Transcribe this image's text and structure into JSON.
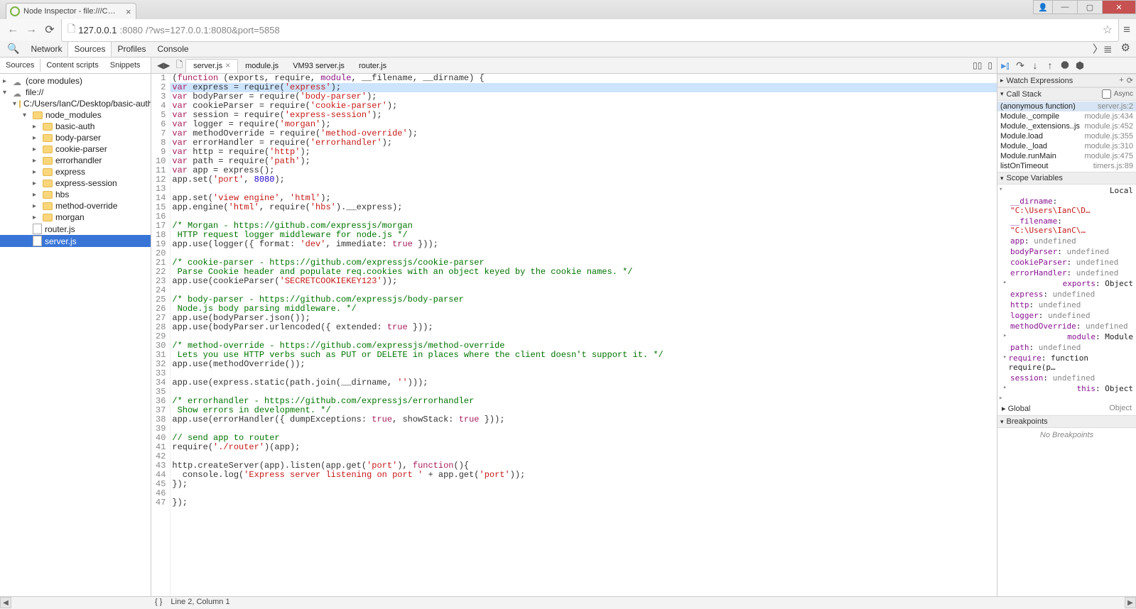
{
  "browser": {
    "tab_title": "Node Inspector - file:///C…",
    "url_host": "127.0.0.1",
    "url_port": ":8080",
    "url_rest": "/?ws=127.0.0.1:8080&port=5858"
  },
  "devtools": {
    "tabs": [
      "Network",
      "Sources",
      "Profiles",
      "Console"
    ],
    "active_tab": "Sources"
  },
  "left_tabs": [
    "Sources",
    "Content scripts",
    "Snippets"
  ],
  "tree": {
    "core": "(core modules)",
    "file": "file://",
    "path": "C:/Users/IanC/Desktop/basic-auth",
    "node_modules": "node_modules",
    "folders": [
      "basic-auth",
      "body-parser",
      "cookie-parser",
      "errorhandler",
      "express",
      "express-session",
      "hbs",
      "method-override",
      "morgan"
    ],
    "files": [
      "router.js",
      "server.js"
    ],
    "selected": "server.js"
  },
  "editor": {
    "tabs": [
      "server.js",
      "module.js",
      "VM93 server.js",
      "router.js"
    ],
    "active": "server.js",
    "status": "Line 2, Column 1"
  },
  "code": [
    {
      "n": 1,
      "t": "(function (exports, require, module, __filename, __dirname) {",
      "tokens": [
        [
          "fn",
          "("
        ],
        [
          "kw",
          "function"
        ],
        [
          "fn",
          " (exports, require, "
        ],
        [
          "obj",
          "module"
        ],
        [
          "fn",
          ", __filename, __dirname) {"
        ]
      ]
    },
    {
      "n": 2,
      "hl": true,
      "tokens": [
        [
          "kw",
          "var"
        ],
        [
          "fn",
          " express = require("
        ],
        [
          "str",
          "'express'"
        ],
        [
          "fn",
          ");"
        ]
      ]
    },
    {
      "n": 3,
      "tokens": [
        [
          "kw",
          "var"
        ],
        [
          "fn",
          " bodyParser = require("
        ],
        [
          "str",
          "'body-parser'"
        ],
        [
          "fn",
          ");"
        ]
      ]
    },
    {
      "n": 4,
      "tokens": [
        [
          "kw",
          "var"
        ],
        [
          "fn",
          " cookieParser = require("
        ],
        [
          "str",
          "'cookie-parser'"
        ],
        [
          "fn",
          ");"
        ]
      ]
    },
    {
      "n": 5,
      "tokens": [
        [
          "kw",
          "var"
        ],
        [
          "fn",
          " session = require("
        ],
        [
          "str",
          "'express-session'"
        ],
        [
          "fn",
          ");"
        ]
      ]
    },
    {
      "n": 6,
      "tokens": [
        [
          "kw",
          "var"
        ],
        [
          "fn",
          " logger = require("
        ],
        [
          "str",
          "'morgan'"
        ],
        [
          "fn",
          ");"
        ]
      ]
    },
    {
      "n": 7,
      "tokens": [
        [
          "kw",
          "var"
        ],
        [
          "fn",
          " methodOverride = require("
        ],
        [
          "str",
          "'method-override'"
        ],
        [
          "fn",
          ");"
        ]
      ]
    },
    {
      "n": 8,
      "tokens": [
        [
          "kw",
          "var"
        ],
        [
          "fn",
          " errorHandler = require("
        ],
        [
          "str",
          "'errorhandler'"
        ],
        [
          "fn",
          ");"
        ]
      ]
    },
    {
      "n": 9,
      "tokens": [
        [
          "kw",
          "var"
        ],
        [
          "fn",
          " http = require("
        ],
        [
          "str",
          "'http'"
        ],
        [
          "fn",
          ");"
        ]
      ]
    },
    {
      "n": 10,
      "tokens": [
        [
          "kw",
          "var"
        ],
        [
          "fn",
          " path = require("
        ],
        [
          "str",
          "'path'"
        ],
        [
          "fn",
          ");"
        ]
      ]
    },
    {
      "n": 11,
      "tokens": [
        [
          "kw",
          "var"
        ],
        [
          "fn",
          " app = express();"
        ]
      ]
    },
    {
      "n": 12,
      "tokens": [
        [
          "fn",
          "app.set("
        ],
        [
          "str",
          "'port'"
        ],
        [
          "fn",
          ", "
        ],
        [
          "num",
          "8080"
        ],
        [
          "fn",
          ");"
        ]
      ]
    },
    {
      "n": 13,
      "tokens": []
    },
    {
      "n": 14,
      "tokens": [
        [
          "fn",
          "app.set("
        ],
        [
          "str",
          "'view engine'"
        ],
        [
          "fn",
          ", "
        ],
        [
          "str",
          "'html'"
        ],
        [
          "fn",
          ");"
        ]
      ]
    },
    {
      "n": 15,
      "tokens": [
        [
          "fn",
          "app.engine("
        ],
        [
          "str",
          "'html'"
        ],
        [
          "fn",
          ", require("
        ],
        [
          "str",
          "'hbs'"
        ],
        [
          "fn",
          ").__express);"
        ]
      ]
    },
    {
      "n": 16,
      "tokens": []
    },
    {
      "n": 17,
      "tokens": [
        [
          "com",
          "/* Morgan - https://github.com/expressjs/morgan"
        ]
      ]
    },
    {
      "n": 18,
      "tokens": [
        [
          "com",
          " HTTP request logger middleware for node.js */"
        ]
      ]
    },
    {
      "n": 19,
      "tokens": [
        [
          "fn",
          "app.use(logger({ format: "
        ],
        [
          "str",
          "'dev'"
        ],
        [
          "fn",
          ", immediate: "
        ],
        [
          "kw",
          "true"
        ],
        [
          "fn",
          " }));"
        ]
      ]
    },
    {
      "n": 20,
      "tokens": []
    },
    {
      "n": 21,
      "tokens": [
        [
          "com",
          "/* cookie-parser - https://github.com/expressjs/cookie-parser"
        ]
      ]
    },
    {
      "n": 22,
      "tokens": [
        [
          "com",
          " Parse Cookie header and populate req.cookies with an object keyed by the cookie names. */"
        ]
      ]
    },
    {
      "n": 23,
      "tokens": [
        [
          "fn",
          "app.use(cookieParser("
        ],
        [
          "str",
          "'SECRETCOOKIEKEY123'"
        ],
        [
          "fn",
          "));"
        ]
      ]
    },
    {
      "n": 24,
      "tokens": []
    },
    {
      "n": 25,
      "tokens": [
        [
          "com",
          "/* body-parser - https://github.com/expressjs/body-parser"
        ]
      ]
    },
    {
      "n": 26,
      "tokens": [
        [
          "com",
          " Node.js body parsing middleware. */"
        ]
      ]
    },
    {
      "n": 27,
      "tokens": [
        [
          "fn",
          "app.use(bodyParser.json());"
        ]
      ]
    },
    {
      "n": 28,
      "tokens": [
        [
          "fn",
          "app.use(bodyParser.urlencoded({ extended: "
        ],
        [
          "kw",
          "true"
        ],
        [
          "fn",
          " }));"
        ]
      ]
    },
    {
      "n": 29,
      "tokens": []
    },
    {
      "n": 30,
      "tokens": [
        [
          "com",
          "/* method-override - https://github.com/expressjs/method-override"
        ]
      ]
    },
    {
      "n": 31,
      "tokens": [
        [
          "com",
          " Lets you use HTTP verbs such as PUT or DELETE in places where the client doesn't support it. */"
        ]
      ]
    },
    {
      "n": 32,
      "tokens": [
        [
          "fn",
          "app.use(methodOverride());"
        ]
      ]
    },
    {
      "n": 33,
      "tokens": []
    },
    {
      "n": 34,
      "tokens": [
        [
          "fn",
          "app.use(express.static(path.join(__dirname, "
        ],
        [
          "str",
          "''"
        ],
        [
          "fn",
          ")));"
        ]
      ]
    },
    {
      "n": 35,
      "tokens": []
    },
    {
      "n": 36,
      "tokens": [
        [
          "com",
          "/* errorhandler - https://github.com/expressjs/errorhandler"
        ]
      ]
    },
    {
      "n": 37,
      "tokens": [
        [
          "com",
          " Show errors in development. */"
        ]
      ]
    },
    {
      "n": 38,
      "tokens": [
        [
          "fn",
          "app.use(errorHandler({ dumpExceptions: "
        ],
        [
          "kw",
          "true"
        ],
        [
          "fn",
          ", showStack: "
        ],
        [
          "kw",
          "true"
        ],
        [
          "fn",
          " }));"
        ]
      ]
    },
    {
      "n": 39,
      "tokens": []
    },
    {
      "n": 40,
      "tokens": [
        [
          "com",
          "// send app to router"
        ]
      ]
    },
    {
      "n": 41,
      "tokens": [
        [
          "fn",
          "require("
        ],
        [
          "str",
          "'./router'"
        ],
        [
          "fn",
          ")(app);"
        ]
      ]
    },
    {
      "n": 42,
      "tokens": []
    },
    {
      "n": 43,
      "tokens": [
        [
          "fn",
          "http.createServer(app).listen(app.get("
        ],
        [
          "str",
          "'port'"
        ],
        [
          "fn",
          "), "
        ],
        [
          "kw",
          "function"
        ],
        [
          "fn",
          "(){"
        ]
      ]
    },
    {
      "n": 44,
      "tokens": [
        [
          "fn",
          "  console.log("
        ],
        [
          "str",
          "'Express server listening on port '"
        ],
        [
          "fn",
          " + app.get("
        ],
        [
          "str",
          "'port'"
        ],
        [
          "fn",
          "));"
        ]
      ]
    },
    {
      "n": 45,
      "tokens": [
        [
          "fn",
          "});"
        ]
      ]
    },
    {
      "n": 46,
      "tokens": []
    },
    {
      "n": 47,
      "tokens": [
        [
          "fn",
          "});"
        ]
      ]
    }
  ],
  "debug": {
    "sections": {
      "watch": "Watch Expressions",
      "callstack": "Call Stack",
      "async": "Async",
      "scope": "Scope Variables",
      "breakpoints": "Breakpoints",
      "no_bp": "No Breakpoints"
    },
    "callstack": [
      {
        "name": "(anonymous function)",
        "loc": "server.js:2",
        "sel": true
      },
      {
        "name": "Module._compile",
        "loc": "module.js:434"
      },
      {
        "name": "Module._extensions..js",
        "loc": "module.js:452"
      },
      {
        "name": "Module.load",
        "loc": "module.js:355"
      },
      {
        "name": "Module._load",
        "loc": "module.js:310"
      },
      {
        "name": "Module.runMain",
        "loc": "module.js:475"
      },
      {
        "name": "listOnTimeout",
        "loc": "timers.js:89"
      }
    ],
    "scope_local_label": "Local",
    "scope": [
      {
        "name": "__dirname",
        "val": "\"C:\\Users\\IanC\\D…",
        "t": "str"
      },
      {
        "name": "__filename",
        "val": "\"C:\\Users\\IanC\\…",
        "t": "str"
      },
      {
        "name": "app",
        "val": "undefined",
        "t": "undef"
      },
      {
        "name": "bodyParser",
        "val": "undefined",
        "t": "undef"
      },
      {
        "name": "cookieParser",
        "val": "undefined",
        "t": "undef"
      },
      {
        "name": "errorHandler",
        "val": "undefined",
        "t": "undef"
      },
      {
        "name": "exports",
        "val": "Object",
        "t": "obj",
        "toggle": true
      },
      {
        "name": "express",
        "val": "undefined",
        "t": "undef"
      },
      {
        "name": "http",
        "val": "undefined",
        "t": "undef"
      },
      {
        "name": "logger",
        "val": "undefined",
        "t": "undef"
      },
      {
        "name": "methodOverride",
        "val": "undefined",
        "t": "undef"
      },
      {
        "name": "module",
        "val": "Module",
        "t": "obj",
        "toggle": true
      },
      {
        "name": "path",
        "val": "undefined",
        "t": "undef"
      },
      {
        "name": "require",
        "val": "function require(p…",
        "t": "obj",
        "toggle": true
      },
      {
        "name": "session",
        "val": "undefined",
        "t": "undef"
      },
      {
        "name": "this",
        "val": "Object",
        "t": "obj",
        "toggle": true
      }
    ],
    "global_label": "Global",
    "global_val": "Object"
  }
}
